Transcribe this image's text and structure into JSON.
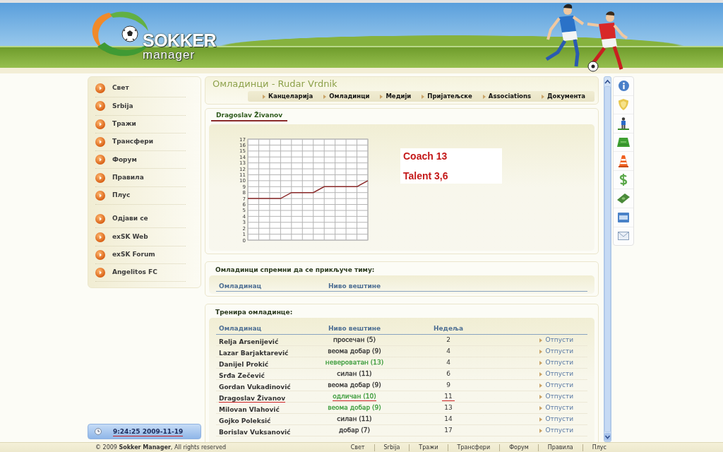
{
  "header": {
    "logo": {
      "title": "SOKKER",
      "subtitle": "manager"
    }
  },
  "sidebar": {
    "sections": [
      {
        "items": [
          "Свет",
          "Srbija",
          "Тражи",
          "Трансфери",
          "Форум",
          "Правила",
          "Плус"
        ]
      },
      {
        "items": [
          "Одјави се",
          "exSK Web",
          "exSK Forum",
          "Angelitos FC"
        ]
      }
    ]
  },
  "clock": {
    "text": "9:24:25 2009-11-19",
    "annotated": true
  },
  "page_title": "Омладинци - Rudar Vrdnik",
  "nav": [
    "Канцеларија",
    "Омладинци",
    "Медији",
    "Пријатељске",
    "Associations",
    "Документа"
  ],
  "player": {
    "tab": "Dragoslav Živanov",
    "chart_data": {
      "type": "line",
      "grid": true,
      "ylim": [
        0,
        17
      ],
      "yticks": [
        0,
        1,
        2,
        3,
        4,
        5,
        6,
        7,
        8,
        9,
        10,
        11,
        12,
        13,
        14,
        15,
        16,
        17
      ],
      "series": [
        {
          "color": "#8b2a2a",
          "values": [
            7,
            7,
            7,
            7,
            8,
            8,
            8,
            9,
            9,
            9,
            9,
            10
          ]
        }
      ]
    },
    "notes": [
      "Coach 13",
      "Talent 3,6"
    ]
  },
  "ready": {
    "title": "Омладинци спремни да се прикључе тиму:",
    "columns": [
      "Омладинац",
      "Ниво вештине"
    ]
  },
  "training": {
    "title": "Тренира омладинце:",
    "columns": [
      "Омладинац",
      "Ниво вештине",
      "Недеља"
    ],
    "rows": [
      {
        "name": "Relja Arsenijević",
        "skill": {
          "text": "просечан (5)",
          "color": "#333333"
        },
        "weeks": "2",
        "action": "Отпусти",
        "annotated": false
      },
      {
        "name": "Lazar Barjaktarević",
        "skill": {
          "text": "веома добар (9)",
          "color": "#333333"
        },
        "weeks": "4",
        "action": "Отпусти",
        "annotated": false
      },
      {
        "name": "Danijel Prokić",
        "skill": {
          "text": "невероватан (13)",
          "color": "#3c9c3c"
        },
        "weeks": "4",
        "action": "Отпусти",
        "annotated": false
      },
      {
        "name": "Srđa Zečević",
        "skill": {
          "text": "силан (11)",
          "color": "#333333"
        },
        "weeks": "6",
        "action": "Отпусти",
        "annotated": false
      },
      {
        "name": "Gordan Vukadinović",
        "skill": {
          "text": "веома добар (9)",
          "color": "#333333"
        },
        "weeks": "9",
        "action": "Отпусти",
        "annotated": false
      },
      {
        "name": "Dragoslav Živanov",
        "skill": {
          "text": "одличан (10)",
          "color": "#3c9c3c"
        },
        "weeks": "11",
        "action": "Отпусти",
        "annotated": true
      },
      {
        "name": "Milovan Vlahović",
        "skill": {
          "text": "веома добар (9)",
          "color": "#3c9c3c"
        },
        "weeks": "13",
        "action": "Отпусти",
        "annotated": false
      },
      {
        "name": "Gojko Poleksić",
        "skill": {
          "text": "силан (11)",
          "color": "#333333"
        },
        "weeks": "14",
        "action": "Отпусти",
        "annotated": false
      },
      {
        "name": "Borislav Vuksanović",
        "skill": {
          "text": "добар (7)",
          "color": "#333333"
        },
        "weeks": "17",
        "action": "Отпусти",
        "annotated": false
      }
    ]
  },
  "footer": {
    "copyright": "© 2009 **Sokker Manager**, All rights reserved",
    "links": [
      "Свет",
      "Srbija",
      "Тражи",
      "Трансфери",
      "Форум",
      "Правила",
      "Плус"
    ]
  }
}
